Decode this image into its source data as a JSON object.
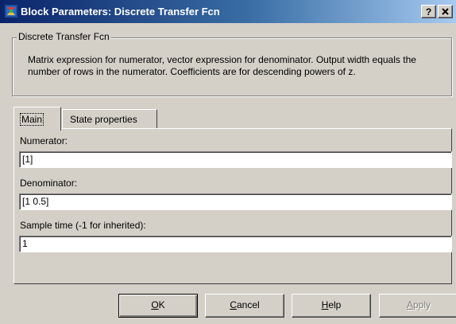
{
  "window": {
    "title": "Block Parameters: Discrete Transfer Fcn",
    "help_glyph": "?",
    "close_glyph": "X"
  },
  "group": {
    "legend": "Discrete Transfer Fcn",
    "description": "Matrix expression for numerator, vector expression for denominator. Output width equals the number of rows in the numerator.  Coefficients are for descending powers of z."
  },
  "tabs": [
    {
      "label": "Main",
      "selected": true
    },
    {
      "label": "State properties",
      "selected": false
    }
  ],
  "fields": {
    "numerator": {
      "label": "Numerator:",
      "value": "[1]"
    },
    "denominator": {
      "label": "Denominator:",
      "value": "[1 0.5]"
    },
    "sample_time": {
      "label": "Sample time (-1 for inherited):",
      "value": "1"
    }
  },
  "buttons": {
    "ok": {
      "mnemonic": "O",
      "rest": "K"
    },
    "cancel": {
      "mnemonic": "C",
      "rest": "ancel"
    },
    "help": {
      "mnemonic": "H",
      "rest": "elp"
    },
    "apply": {
      "mnemonic": "A",
      "rest": "pply",
      "enabled": false
    }
  },
  "colors": {
    "title_start": "#0a246a",
    "title_end": "#a6caf0",
    "face": "#d4d0c8"
  },
  "icons": [
    "simulink-block-icon"
  ]
}
